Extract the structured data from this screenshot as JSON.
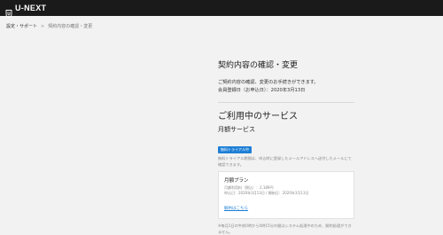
{
  "header": {
    "logo_text": "U-NEXT"
  },
  "breadcrumb": {
    "parent": "設定・サポート",
    "separator": ">",
    "current": "契約内容の確認・変更"
  },
  "main": {
    "title": "契約内容の確認・変更",
    "description": "ご契約内容の確認、変更のお手続きができます。",
    "registration_date": "会員登録日（お申込日）：2020年3月13日"
  },
  "services": {
    "section_title": "ご利用中のサービス",
    "sub_title": "月額サービス",
    "trial_badge": "無料トライアル中",
    "trial_note": "無料トライアル期間は、申込時に登録したメールアドレスへ送付したメールにて確認できます。",
    "plan": {
      "name": "月額プラン",
      "price": "月額利用料（税込）：2,189円",
      "dates": "申込日：2020年3月13日 / 開始日：2020年3月13日",
      "cancel_link": "解約はこちら"
    },
    "footnote": "※毎月1日の午前0時から0時15分の間はシステム処理中のため、解約処理ができません。"
  },
  "colors": {
    "header_bg": "#1a1a1a",
    "accent": "#1e7fd6",
    "page_bg": "#f2f2f2"
  },
  "icons": {
    "logo": "u-next-shield-icon"
  }
}
